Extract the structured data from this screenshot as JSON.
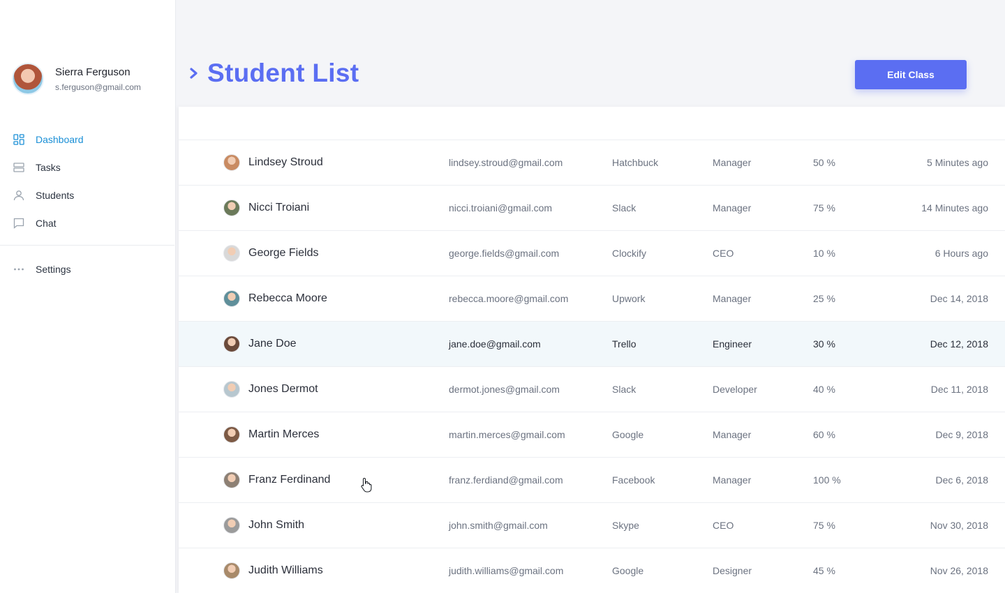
{
  "profile": {
    "name": "Sierra Ferguson",
    "email": "s.ferguson@gmail.com"
  },
  "nav": {
    "items": [
      {
        "label": "Dashboard",
        "icon": "dashboard-icon",
        "active": true
      },
      {
        "label": "Tasks",
        "icon": "tasks-icon",
        "active": false
      },
      {
        "label": "Students",
        "icon": "user-icon",
        "active": false
      },
      {
        "label": "Chat",
        "icon": "chat-icon",
        "active": false
      }
    ],
    "settings": {
      "label": "Settings",
      "icon": "more-dots-icon"
    }
  },
  "header": {
    "title": "Student List",
    "edit_button": "Edit Class"
  },
  "colors": {
    "accent": "#5b6ef2",
    "active_nav": "#1a8fd6",
    "highlight_row": "#f2f8fb"
  },
  "students": [
    {
      "name": "Lindsey Stroud",
      "email": "lindsey.stroud@gmail.com",
      "company": "Hatchbuck",
      "role": "Manager",
      "progress": "50 %",
      "time": "5 Minutes ago",
      "avatar_color": "#c98b62"
    },
    {
      "name": "Nicci Troiani",
      "email": "nicci.troiani@gmail.com",
      "company": "Slack",
      "role": "Manager",
      "progress": "75 %",
      "time": "14 Minutes ago",
      "avatar_color": "#6b7a5a"
    },
    {
      "name": "George Fields",
      "email": "george.fields@gmail.com",
      "company": "Clockify",
      "role": "CEO",
      "progress": "10 %",
      "time": "6 Hours ago",
      "avatar_color": "#d9d9d9"
    },
    {
      "name": "Rebecca Moore",
      "email": "rebecca.moore@gmail.com",
      "company": "Upwork",
      "role": "Manager",
      "progress": "25 %",
      "time": "Dec 14, 2018",
      "avatar_color": "#5f8f9a"
    },
    {
      "name": "Jane Doe",
      "email": "jane.doe@gmail.com",
      "company": "Trello",
      "role": "Engineer",
      "progress": "30 %",
      "time": "Dec 12, 2018",
      "avatar_color": "#6a4a3a",
      "highlighted": true
    },
    {
      "name": "Jones Dermot",
      "email": "dermot.jones@gmail.com",
      "company": "Slack",
      "role": "Developer",
      "progress": "40 %",
      "time": "Dec 11, 2018",
      "avatar_color": "#b7c7cf"
    },
    {
      "name": "Martin Merces",
      "email": "martin.merces@gmail.com",
      "company": "Google",
      "role": "Manager",
      "progress": "60 %",
      "time": "Dec 9, 2018",
      "avatar_color": "#7d5a45"
    },
    {
      "name": "Franz Ferdinand",
      "email": "franz.ferdiand@gmail.com",
      "company": "Facebook",
      "role": "Manager",
      "progress": "100 %",
      "time": "Dec 6, 2018",
      "avatar_color": "#8d8074"
    },
    {
      "name": "John Smith",
      "email": "john.smith@gmail.com",
      "company": "Skype",
      "role": "CEO",
      "progress": "75 %",
      "time": "Nov 30, 2018",
      "avatar_color": "#9b9b9b"
    },
    {
      "name": "Judith Williams",
      "email": "judith.williams@gmail.com",
      "company": "Google",
      "role": "Designer",
      "progress": "45 %",
      "time": "Nov 26, 2018",
      "avatar_color": "#a88a6a"
    }
  ]
}
